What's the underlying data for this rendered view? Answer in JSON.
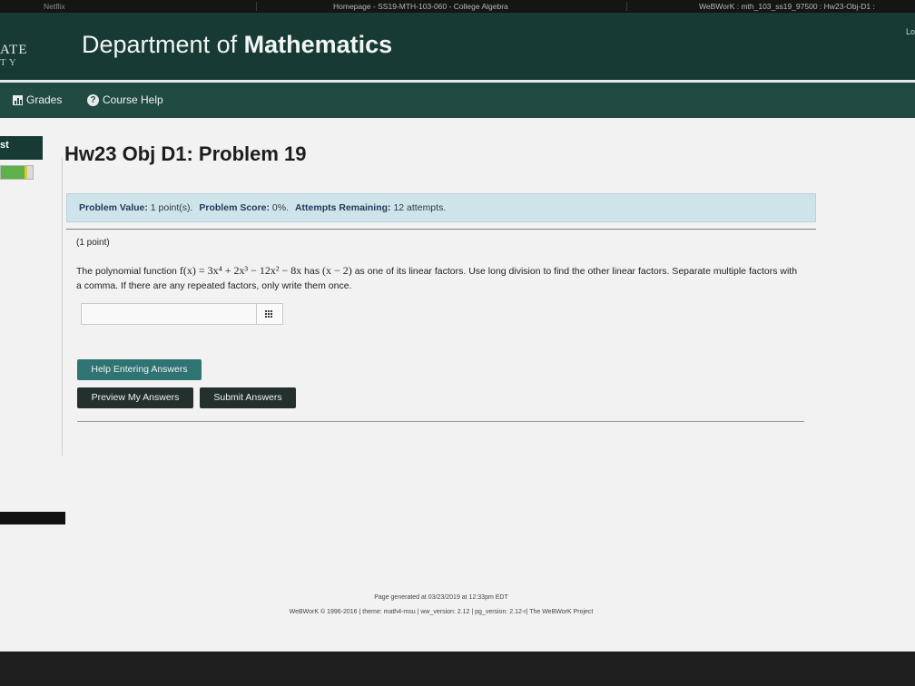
{
  "browser_tabs": [
    "Netflix",
    "Homepage - SS19-MTH-103-060 - College Algebra",
    "WeBWorK : mth_103_ss19_97500 : Hw23-Obj-D1 :"
  ],
  "header": {
    "logo_line1": "ATE",
    "logo_line2": "TY",
    "title_prefix": "Department of ",
    "title_bold": "Mathematics",
    "logout_label": "Lo"
  },
  "nav": {
    "grades_label": "Grades",
    "course_help_label": "Course Help"
  },
  "sidebar": {
    "label": "st",
    "progress": 0.82
  },
  "problem": {
    "title": "Hw23 Obj D1: Problem 19",
    "info": {
      "value_label": "Problem Value:",
      "value_text": "1 point(s).",
      "score_label": "Problem Score:",
      "score_text": "0%.",
      "attempts_label": "Attempts Remaining:",
      "attempts_text": "12 attempts."
    },
    "points": "(1 point)",
    "statement_before": "The polynomial function ",
    "function": "f(x) = 3x⁴ + 2x³ − 12x² − 8x",
    "statement_has": " has ",
    "factor": "(x − 2)",
    "statement_after": " as one of its linear factors. Use long division to find the other linear factors. Separate multiple factors with a comma. If there are any repeated factors, only write them once.",
    "answer_value": ""
  },
  "buttons": {
    "help_label": "Help Entering Answers",
    "preview_label": "Preview My Answers",
    "submit_label": "Submit Answers"
  },
  "footer": {
    "generated": "Page generated at 03/23/2019 at 12:33pm EDT",
    "credits": "WeBWorK © 1996-2016 | theme: math4-msu | ww_version: 2.12 | pg_version: 2.12-r| The WeBWorK Project"
  },
  "colors": {
    "header_bg": "#173b34",
    "nav_bg": "#214a42",
    "info_bg": "#cfe4ea",
    "help_button": "#2f7373",
    "dark_button": "#23302e",
    "progress_green": "#5db04a"
  }
}
